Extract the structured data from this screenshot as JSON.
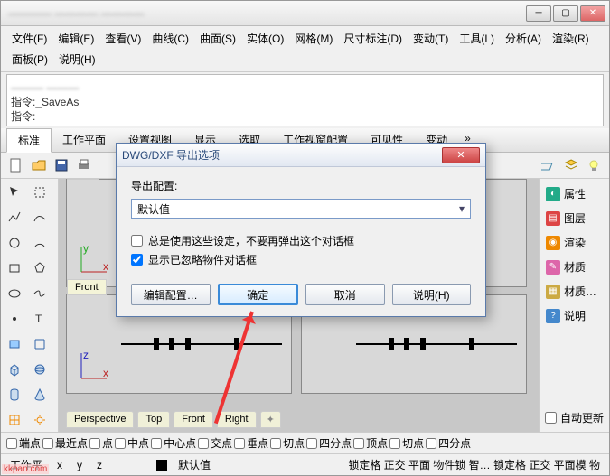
{
  "titlebar": {
    "title": "———— ———— ————"
  },
  "menu": {
    "file": "文件(F)",
    "edit": "编辑(E)",
    "view": "查看(V)",
    "curve": "曲线(C)",
    "surface": "曲面(S)",
    "solid": "实体(O)",
    "mesh": "网格(M)",
    "dimension": "尺寸标注(D)",
    "transform": "变动(T)",
    "tools": "工具(L)",
    "analyze": "分析(A)",
    "render": "渲染(R)",
    "panels": "面板(P)",
    "help": "说明(H)"
  },
  "cmd": {
    "prev_blur": "——— ———",
    "prev": "指令:_SaveAs",
    "prompt": "指令:"
  },
  "tabs": {
    "std": "标准",
    "cplane": "工作平面",
    "setview": "设置视图",
    "display": "显示",
    "select": "选取",
    "vplayout": "工作视窗配置",
    "visibility": "可见性",
    "transform": "变动",
    "more": "»"
  },
  "viewports": {
    "top": "Top",
    "front": "Front",
    "perspective": "Perspective",
    "right": "Right",
    "axes": {
      "x": "x",
      "y": "y",
      "z": "z"
    }
  },
  "right": {
    "properties": "属性",
    "layers": "图层",
    "render": "渲染",
    "materials": "材质",
    "materials_lib": "材质…",
    "help": "说明",
    "auto_update": "自动更新"
  },
  "osnap": {
    "end": "端点",
    "near": "最近点",
    "point": "点",
    "mid": "中点",
    "cen": "中心点",
    "int": "交点",
    "perp": "垂点",
    "tan": "切点",
    "quad": "四分点",
    "vert": "顶点",
    "knot": "切点",
    "quad2": "四分点"
  },
  "status": {
    "cplane": "工作平",
    "x": "x",
    "y": "y",
    "z": "z",
    "default": "默认值",
    "flags": "锁定格 正交 平面 物件锁 智… 锁定格 正交 平面模 物"
  },
  "dialog": {
    "title": "DWG/DXF 导出选项",
    "export_cfg": "导出配置:",
    "cfg_value": "默认值",
    "chk_always": "总是使用这些设定，不要再弹出这个对话框",
    "chk_show_skipped": "显示已忽略物件对话框",
    "btn_edit": "编辑配置…",
    "btn_ok": "确定",
    "btn_cancel": "取消",
    "btn_help": "说明(H)"
  },
  "watermark": "kkpan.com"
}
